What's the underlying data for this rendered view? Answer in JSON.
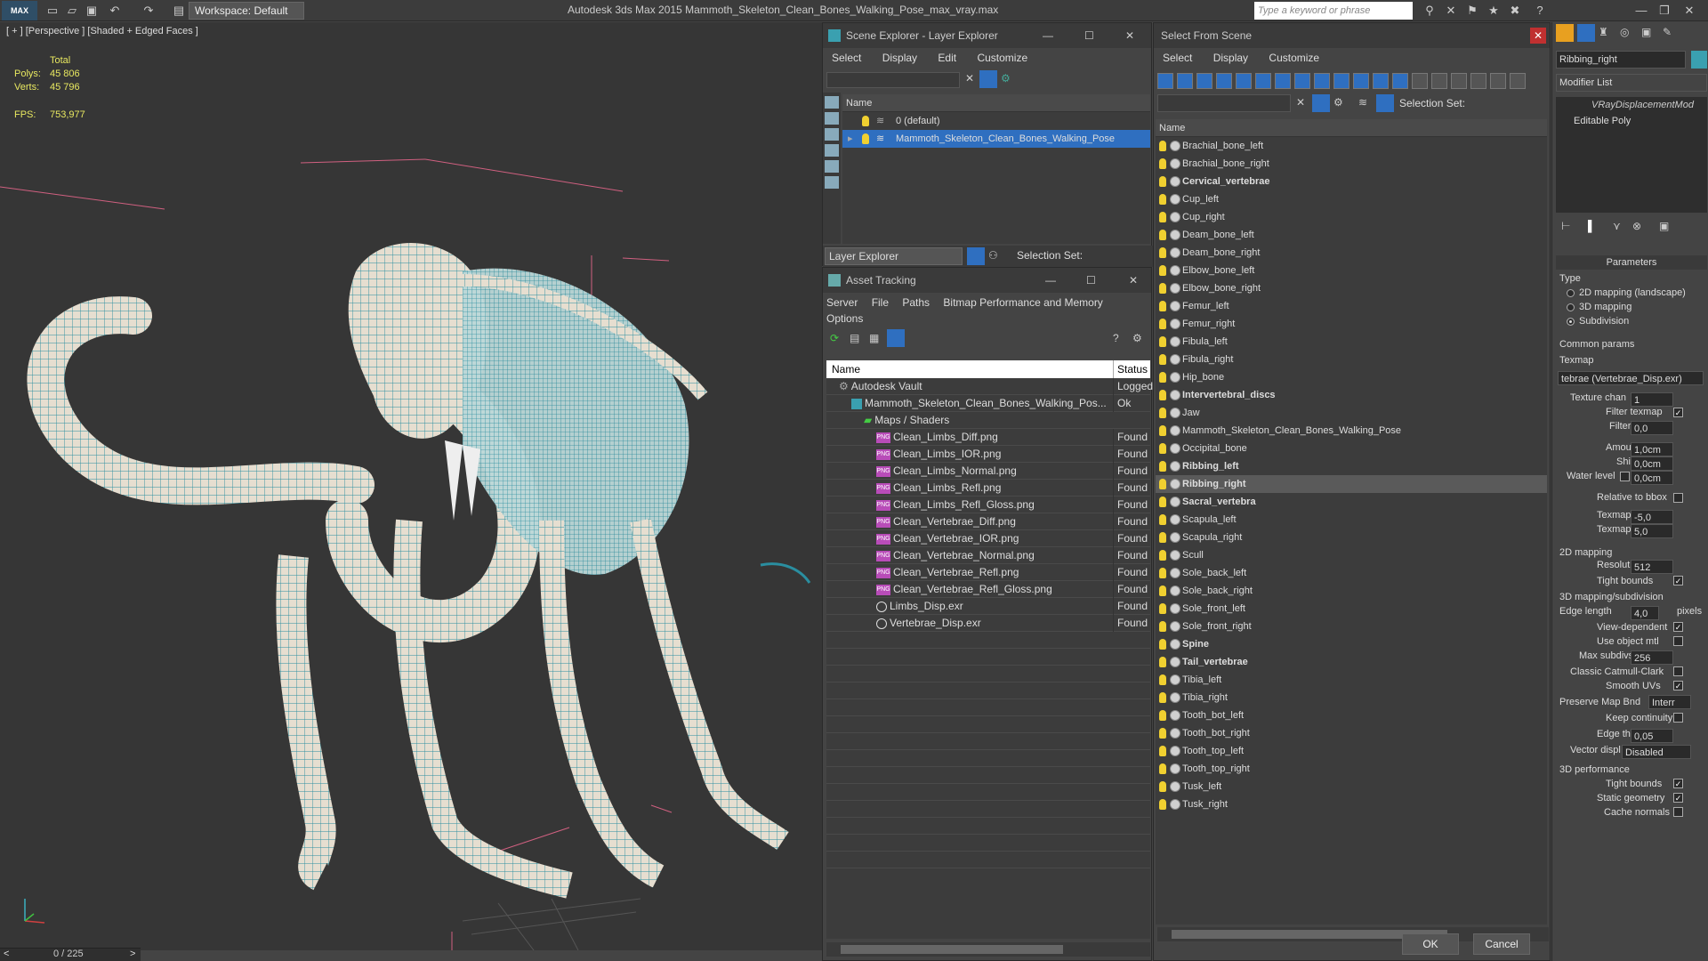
{
  "app": {
    "logo": "MAX",
    "title": "Autodesk 3ds Max  2015     Mammoth_Skeleton_Clean_Bones_Walking_Pose_max_vray.max",
    "workspace": "Workspace: Default",
    "search_placeholder": "Type a keyword or phrase"
  },
  "viewport": {
    "label": "[ + ] [Perspective ] [Shaded + Edged Faces ]",
    "stats": {
      "total_label": "Total",
      "polys_label": "Polys:",
      "polys_value": "45 806",
      "verts_label": "Verts:",
      "verts_value": "45 796",
      "fps_label": "FPS:",
      "fps_value": "753,977"
    },
    "frame": "0 / 225"
  },
  "layer_explorer": {
    "title": "Scene Explorer - Layer Explorer",
    "menu": [
      "Select",
      "Display",
      "Edit",
      "Customize"
    ],
    "column": "Name",
    "rows": [
      {
        "label": "0 (default)",
        "selected": false
      },
      {
        "label": "Mammoth_Skeleton_Clean_Bones_Walking_Pose",
        "selected": true
      }
    ],
    "footer_dropdown": "Layer Explorer",
    "selection_set": "Selection Set:"
  },
  "asset_tracking": {
    "title": "Asset Tracking",
    "menu": [
      "Server",
      "File",
      "Paths",
      "Bitmap Performance and Memory",
      "Options"
    ],
    "col_name": "Name",
    "col_status": "Status",
    "rows": [
      {
        "name": "Autodesk Vault",
        "status": "Logged",
        "kind": "vault",
        "indent": 1
      },
      {
        "name": "Mammoth_Skeleton_Clean_Bones_Walking_Pos...",
        "status": "Ok",
        "kind": "max",
        "indent": 2
      },
      {
        "name": "Maps / Shaders",
        "status": "",
        "kind": "folder",
        "indent": 3
      },
      {
        "name": "Clean_Limbs_Diff.png",
        "status": "Found",
        "kind": "png",
        "indent": 4
      },
      {
        "name": "Clean_Limbs_IOR.png",
        "status": "Found",
        "kind": "png",
        "indent": 4
      },
      {
        "name": "Clean_Limbs_Normal.png",
        "status": "Found",
        "kind": "png",
        "indent": 4
      },
      {
        "name": "Clean_Limbs_Refl.png",
        "status": "Found",
        "kind": "png",
        "indent": 4
      },
      {
        "name": "Clean_Limbs_Refl_Gloss.png",
        "status": "Found",
        "kind": "png",
        "indent": 4
      },
      {
        "name": "Clean_Vertebrae_Diff.png",
        "status": "Found",
        "kind": "png",
        "indent": 4
      },
      {
        "name": "Clean_Vertebrae_IOR.png",
        "status": "Found",
        "kind": "png",
        "indent": 4
      },
      {
        "name": "Clean_Vertebrae_Normal.png",
        "status": "Found",
        "kind": "png",
        "indent": 4
      },
      {
        "name": "Clean_Vertebrae_Refl.png",
        "status": "Found",
        "kind": "png",
        "indent": 4
      },
      {
        "name": "Clean_Vertebrae_Refl_Gloss.png",
        "status": "Found",
        "kind": "png",
        "indent": 4
      },
      {
        "name": "Limbs_Disp.exr",
        "status": "Found",
        "kind": "exr",
        "indent": 4
      },
      {
        "name": "Vertebrae_Disp.exr",
        "status": "Found",
        "kind": "exr",
        "indent": 4
      }
    ]
  },
  "select_from_scene": {
    "title": "Select From Scene",
    "menu": [
      "Select",
      "Display",
      "Customize"
    ],
    "selection_set": "Selection Set:",
    "column": "Name",
    "items": [
      {
        "label": "Brachial_bone_left",
        "bold": false,
        "selected": false
      },
      {
        "label": "Brachial_bone_right",
        "bold": false,
        "selected": false
      },
      {
        "label": "Cervical_vertebrae",
        "bold": true,
        "selected": false
      },
      {
        "label": "Cup_left",
        "bold": false,
        "selected": false
      },
      {
        "label": "Cup_right",
        "bold": false,
        "selected": false
      },
      {
        "label": "Deam_bone_left",
        "bold": false,
        "selected": false
      },
      {
        "label": "Deam_bone_right",
        "bold": false,
        "selected": false
      },
      {
        "label": "Elbow_bone_left",
        "bold": false,
        "selected": false
      },
      {
        "label": "Elbow_bone_right",
        "bold": false,
        "selected": false
      },
      {
        "label": "Femur_left",
        "bold": false,
        "selected": false
      },
      {
        "label": "Femur_right",
        "bold": false,
        "selected": false
      },
      {
        "label": "Fibula_left",
        "bold": false,
        "selected": false
      },
      {
        "label": "Fibula_right",
        "bold": false,
        "selected": false
      },
      {
        "label": "Hip_bone",
        "bold": false,
        "selected": false
      },
      {
        "label": "Intervertebral_discs",
        "bold": true,
        "selected": false
      },
      {
        "label": "Jaw",
        "bold": false,
        "selected": false
      },
      {
        "label": "Mammoth_Skeleton_Clean_Bones_Walking_Pose",
        "bold": false,
        "selected": false
      },
      {
        "label": "Occipital_bone",
        "bold": false,
        "selected": false
      },
      {
        "label": "Ribbing_left",
        "bold": true,
        "selected": false
      },
      {
        "label": "Ribbing_right",
        "bold": true,
        "selected": true
      },
      {
        "label": "Sacral_vertebra",
        "bold": true,
        "selected": false
      },
      {
        "label": "Scapula_left",
        "bold": false,
        "selected": false
      },
      {
        "label": "Scapula_right",
        "bold": false,
        "selected": false
      },
      {
        "label": "Scull",
        "bold": false,
        "selected": false
      },
      {
        "label": "Sole_back_left",
        "bold": false,
        "selected": false
      },
      {
        "label": "Sole_back_right",
        "bold": false,
        "selected": false
      },
      {
        "label": "Sole_front_left",
        "bold": false,
        "selected": false
      },
      {
        "label": "Sole_front_right",
        "bold": false,
        "selected": false
      },
      {
        "label": "Spine",
        "bold": true,
        "selected": false
      },
      {
        "label": "Tail_vertebrae",
        "bold": true,
        "selected": false
      },
      {
        "label": "Tibia_left",
        "bold": false,
        "selected": false
      },
      {
        "label": "Tibia_right",
        "bold": false,
        "selected": false
      },
      {
        "label": "Tooth_bot_left",
        "bold": false,
        "selected": false
      },
      {
        "label": "Tooth_bot_right",
        "bold": false,
        "selected": false
      },
      {
        "label": "Tooth_top_left",
        "bold": false,
        "selected": false
      },
      {
        "label": "Tooth_top_right",
        "bold": false,
        "selected": false
      },
      {
        "label": "Tusk_left",
        "bold": false,
        "selected": false
      },
      {
        "label": "Tusk_right",
        "bold": false,
        "selected": false
      }
    ],
    "ok": "OK",
    "cancel": "Cancel"
  },
  "modifier": {
    "object_name": "Ribbing_right",
    "modifier_list": "Modifier List",
    "stack": [
      "VRayDisplacementMod",
      "Editable Poly"
    ],
    "params_title": "Parameters",
    "type_label": "Type",
    "type_options": [
      "2D mapping (landscape)",
      "3D mapping",
      "Subdivision"
    ],
    "type_selected": 2,
    "common_params": "Common params",
    "texmap_label": "Texmap",
    "texmap_value": "tebrae (Vertebrae_Disp.exr)",
    "texture_chan_label": "Texture chan",
    "texture_chan": "1",
    "filter_texmap_label": "Filter texmap",
    "filter_blur_label": "Filter blur",
    "filter_blur": "0,0",
    "amount_label": "Amount",
    "amount": "1,0cm",
    "shift_label": "Shift",
    "shift": "0,0cm",
    "water_level_label": "Water level",
    "water_level": "0,0cm",
    "relative_bbox_label": "Relative to bbox",
    "texmap_min_label": "Texmap min",
    "texmap_min": "-5,0",
    "texmap_max_label": "Texmap max",
    "texmap_max": "5,0",
    "mapping2d": "2D mapping",
    "resolution_label": "Resolution",
    "resolution": "512",
    "tight_bounds_label": "Tight bounds",
    "mapping3d": "3D mapping/subdivision",
    "edge_length_label": "Edge length",
    "edge_length": "4,0",
    "pixels_label": "pixels",
    "view_dependent_label": "View-dependent",
    "use_object_mtl_label": "Use object mtl",
    "max_subdivs_label": "Max subdivs",
    "max_subdivs": "256",
    "classic_label": "Classic Catmull-Clark",
    "smooth_uvs_label": "Smooth UVs",
    "preserve_label": "Preserve Map Bnd",
    "preserve_value": "Interr",
    "keep_continuity_label": "Keep continuity",
    "edge_thresh_label": "Edge thresh",
    "edge_thresh": "0,05",
    "vector_displ_label": "Vector displ",
    "vector_displ": "Disabled",
    "perf3d": "3D performance",
    "tight_bounds2_label": "Tight bounds",
    "static_geometry_label": "Static geometry",
    "cache_normals_label": "Cache normals"
  },
  "colors": {
    "accent_blue": "#2f6fc0",
    "mesh_teal": "#2a8ea0",
    "bone": "#e8e0d0",
    "stat_yellow": "#e8e860"
  }
}
